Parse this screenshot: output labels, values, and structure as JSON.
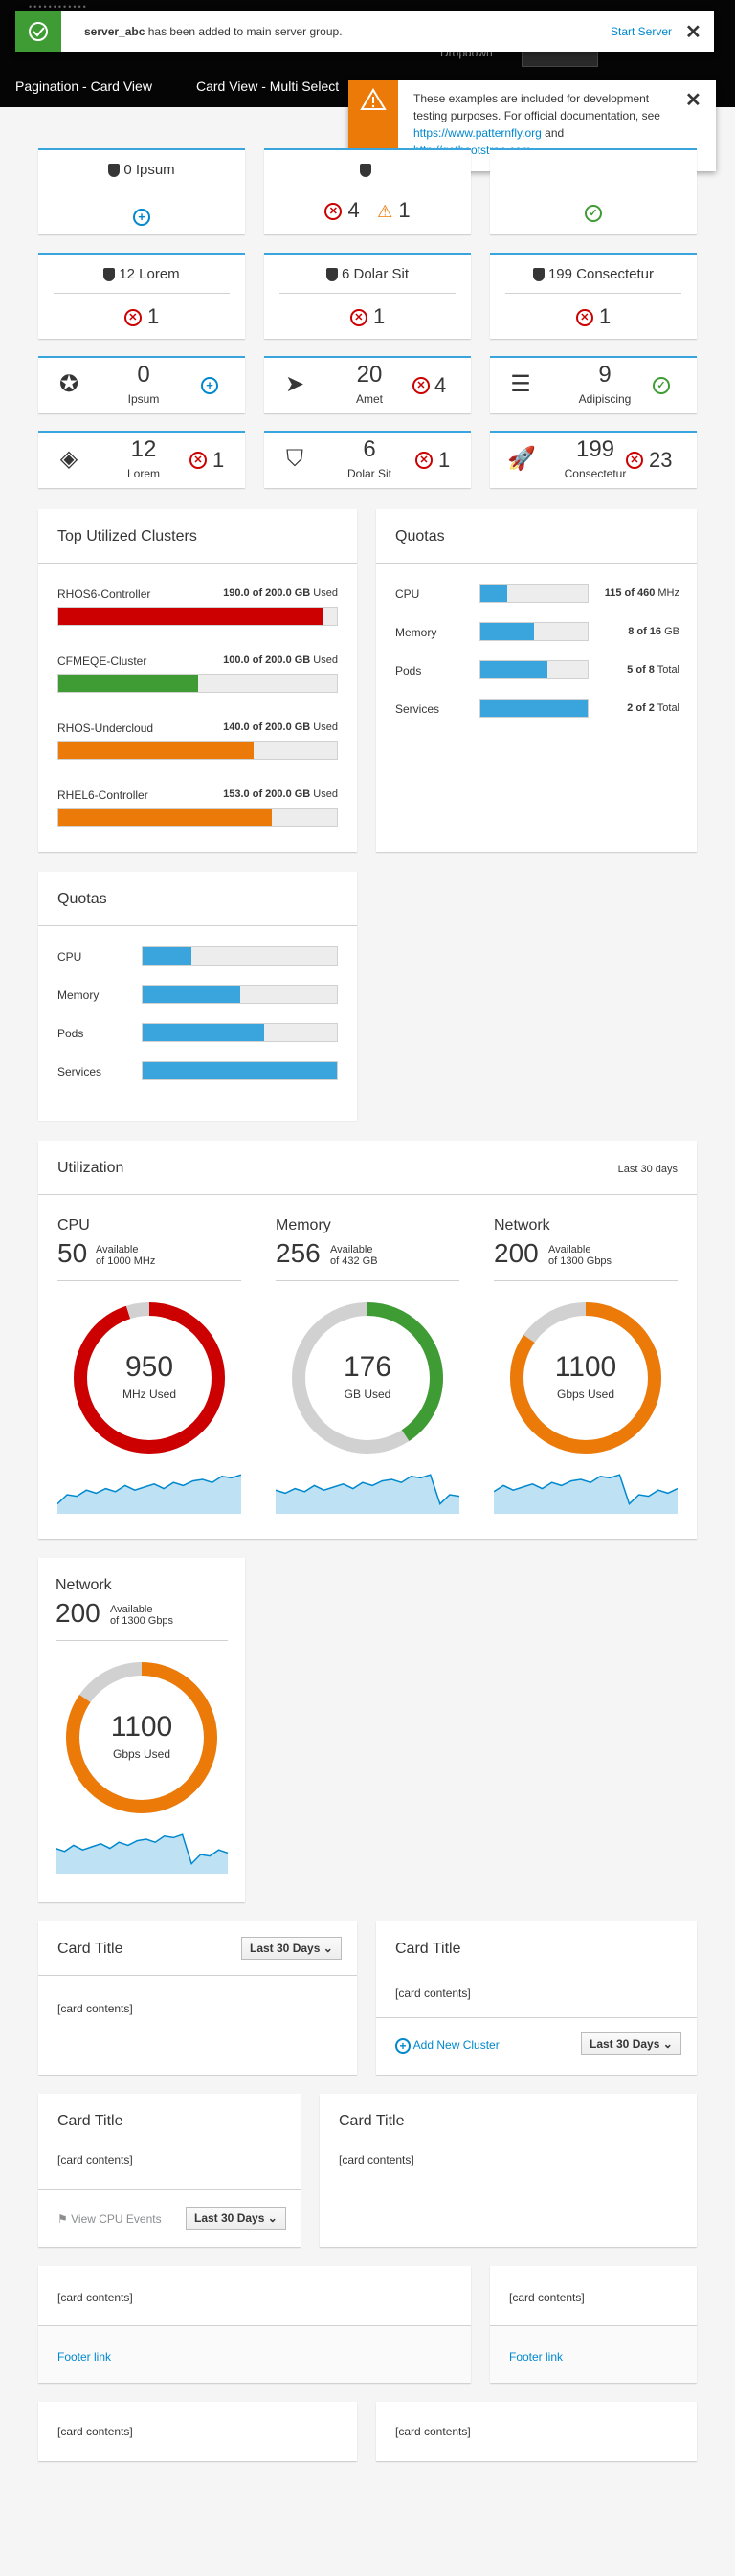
{
  "navbar": {
    "tabs": [
      "Pagination - Card View",
      "Card View - Multi Select"
    ],
    "extra": "Dropdown"
  },
  "toast_success": {
    "server": "server_abc",
    "message": " has been added to main server group.",
    "action": "Start Server",
    "close": "✕"
  },
  "toast_warning": {
    "line1": "These examples are included for development",
    "line2": "testing purposes. For official documentation, see",
    "link1": "https://www.patternfly.org",
    "and": " and",
    "link2": "http://getbootstrap.com",
    "period": ".",
    "close": "✕"
  },
  "agg_row1": [
    {
      "title": "0 Ipsum",
      "icon": "add-icon"
    },
    {
      "title": "",
      "err": "4",
      "warn": "1"
    },
    {
      "title": "",
      "icon": "ok-icon"
    }
  ],
  "agg_row2": [
    {
      "title": "12 Lorem",
      "err": "1"
    },
    {
      "title": "6 Dolar Sit",
      "err": "1"
    },
    {
      "title": "199 Consectetur",
      "err": "1"
    }
  ],
  "mini_row1": [
    {
      "icon": "rebel-icon",
      "num": "0",
      "label": "Ipsum",
      "status": "add",
      "count": ""
    },
    {
      "icon": "paper-plane-icon",
      "num": "20",
      "label": "Amet",
      "status": "err",
      "count": "4"
    },
    {
      "icon": "server-icon",
      "num": "9",
      "label": "Adipiscing",
      "status": "ok",
      "count": ""
    }
  ],
  "mini_row2": [
    {
      "icon": "cubes-icon",
      "num": "12",
      "label": "Lorem",
      "status": "err",
      "count": "1"
    },
    {
      "icon": "shield-icon",
      "num": "6",
      "label": "Dolar Sit",
      "status": "err",
      "count": "1"
    },
    {
      "icon": "rocket-icon",
      "num": "199",
      "label": "Consectetur",
      "status": "err",
      "count": "23"
    }
  ],
  "clusters": {
    "title": "Top Utilized Clusters",
    "items": [
      {
        "name": "RHOS6-Controller",
        "used": "190.0 of 200.0 GB",
        "suffix": " Used",
        "pct": 95,
        "color": "#cc0000"
      },
      {
        "name": "CFMEQE-Cluster",
        "used": "100.0 of 200.0 GB",
        "suffix": " Used",
        "pct": 50,
        "color": "#3f9c35"
      },
      {
        "name": "RHOS-Undercloud",
        "used": "140.0 of 200.0 GB",
        "suffix": " Used",
        "pct": 70,
        "color": "#ec7a08"
      },
      {
        "name": "RHEL6-Controller",
        "used": "153.0 of 200.0 GB",
        "suffix": " Used",
        "pct": 76.5,
        "color": "#ec7a08"
      }
    ]
  },
  "quotas1": {
    "title": "Quotas",
    "items": [
      {
        "name": "CPU",
        "val": "115 of 460",
        "suffix": " MHz",
        "pct": 25
      },
      {
        "name": "Memory",
        "val": "8 of 16",
        "suffix": " GB",
        "pct": 50
      },
      {
        "name": "Pods",
        "val": "5 of 8",
        "suffix": " Total",
        "pct": 62.5
      },
      {
        "name": "Services",
        "val": "2 of 2",
        "suffix": " Total",
        "pct": 100
      }
    ]
  },
  "quotas2": {
    "title": "Quotas",
    "items": [
      {
        "name": "CPU",
        "pct": 25
      },
      {
        "name": "Memory",
        "pct": 50
      },
      {
        "name": "Pods",
        "pct": 62.5
      },
      {
        "name": "Services",
        "pct": 100
      }
    ]
  },
  "utilization": {
    "title": "Utilization",
    "range": "Last 30 days",
    "cols": [
      {
        "name": "CPU",
        "avail": "50",
        "avail_word": "Available",
        "of": "of 1000 MHz",
        "used": "950",
        "unit": "MHz Used",
        "pct": 95,
        "color": "#cc0000"
      },
      {
        "name": "Memory",
        "avail": "256",
        "avail_word": "Available",
        "of": "of 432 GB",
        "used": "176",
        "unit": "GB Used",
        "pct": 40.7,
        "color": "#3f9c35"
      },
      {
        "name": "Network",
        "avail": "200",
        "avail_word": "Available",
        "of": "of 1300 Gbps",
        "used": "1100",
        "unit": "Gbps Used",
        "pct": 84.6,
        "color": "#ec7a08"
      }
    ]
  },
  "network_card": {
    "name": "Network",
    "avail": "200",
    "avail_word": "Available",
    "of": "of 1300 Gbps",
    "used": "1100",
    "unit": "Gbps Used",
    "pct": 84.6,
    "color": "#ec7a08"
  },
  "cards": {
    "title": "Card Title",
    "contents": "[card contents]",
    "select": "Last 30 Days",
    "add_cluster": "Add New Cluster",
    "cpu_events": "View CPU Events",
    "footer_link": "Footer link"
  },
  "colors": {
    "accent": "#39a5dc",
    "danger": "#cc0000",
    "success": "#3f9c35",
    "warning": "#ec7a08",
    "link": "#0088ce"
  }
}
